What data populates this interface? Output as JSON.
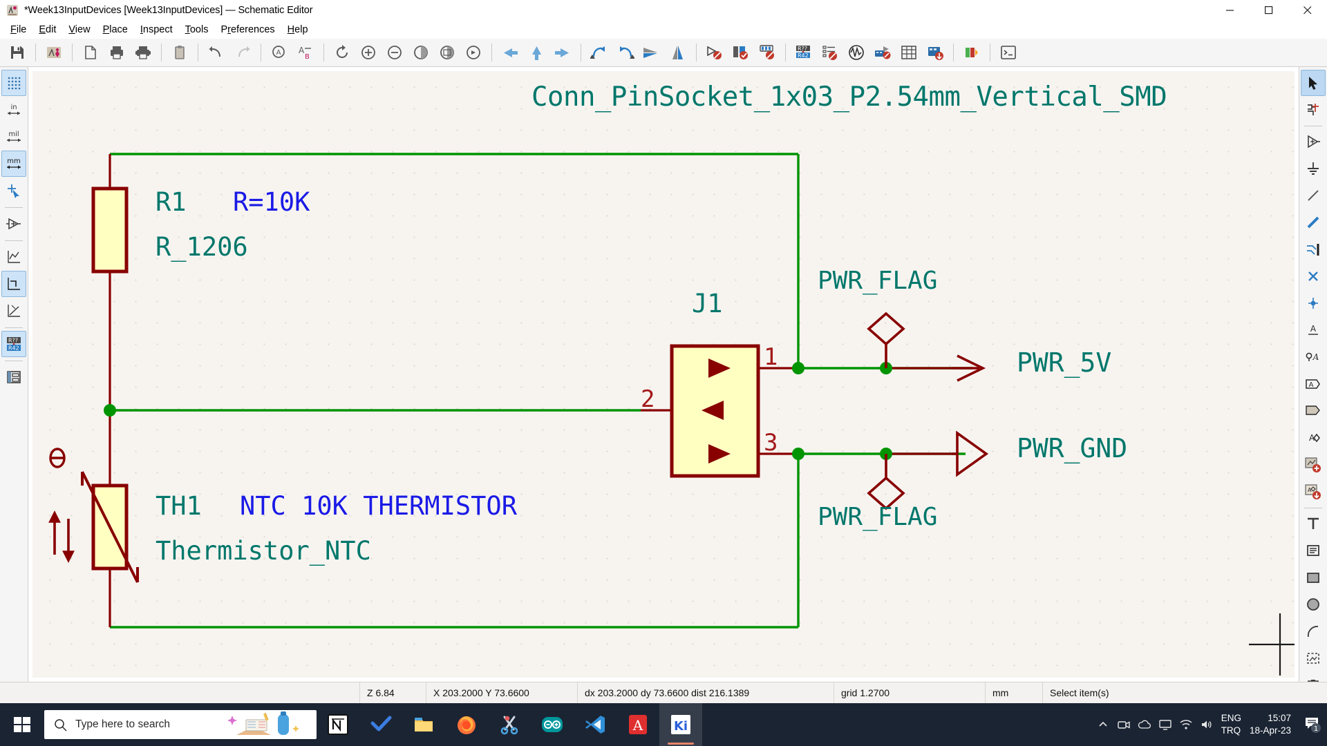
{
  "window": {
    "title": "*Week13InputDevices [Week13InputDevices] — Schematic Editor",
    "app_icon": "kicad-schematic-icon",
    "minimize": "–",
    "maximize": "☐",
    "close": "✕"
  },
  "menu": {
    "items": [
      {
        "label": "File",
        "mnemonic": "F"
      },
      {
        "label": "Edit",
        "mnemonic": "E"
      },
      {
        "label": "View",
        "mnemonic": "V"
      },
      {
        "label": "Place",
        "mnemonic": "P"
      },
      {
        "label": "Inspect",
        "mnemonic": "I"
      },
      {
        "label": "Tools",
        "mnemonic": "T"
      },
      {
        "label": "Preferences",
        "mnemonic": "r"
      },
      {
        "label": "Help",
        "mnemonic": "H"
      }
    ]
  },
  "toolbar": {
    "groups": [
      [
        "save-icon"
      ],
      [
        "open-project-manager-icon"
      ],
      [
        "new-sheet-icon",
        "print-icon",
        "plot-icon"
      ],
      [
        "paste-icon"
      ],
      [
        "undo-icon",
        "redo-icon"
      ],
      [
        "find-icon",
        "find-replace-icon"
      ],
      [
        "refresh-icon",
        "zoom-in-icon",
        "zoom-out-icon",
        "zoom-fit-icon",
        "zoom-objects-icon",
        "zoom-area-icon"
      ],
      [
        "leave-sheet-icon",
        "up-sheet-icon",
        "enter-sheet-icon"
      ],
      [
        "rotate-ccw-icon",
        "rotate-cw-icon",
        "mirror-horizontal-icon",
        "mirror-vertical-icon"
      ],
      [
        "annotate-icon",
        "erc-icon",
        "footprint-assign-icon"
      ],
      [
        "edit-symbol-fields-icon",
        "bom-icon",
        "simulator-icon",
        "open-pcb-icon",
        "spreadsheet-icon",
        "update-pcb-icon"
      ],
      [
        "library-editor-icon"
      ],
      [
        "scripting-console-icon"
      ]
    ]
  },
  "left_toolbar": {
    "items": [
      {
        "name": "toggle-grid-icon",
        "label": "",
        "selected": true
      },
      {
        "name": "units-inches-icon",
        "label": "in",
        "selected": false
      },
      {
        "name": "units-mils-icon",
        "label": "mil",
        "selected": false
      },
      {
        "name": "units-millimeters-icon",
        "label": "mm",
        "selected": true
      },
      {
        "name": "toggle-cursor-icon",
        "label": "",
        "selected": false
      },
      {
        "name": "hidden-pins-icon",
        "label": "",
        "selected": false
      },
      {
        "name": "free-angle-lines-icon",
        "label": "",
        "selected": false
      },
      {
        "name": "ortho-lines-icon",
        "label": "",
        "selected": true
      },
      {
        "name": "any-angle-lines-icon",
        "label": "",
        "selected": false
      },
      {
        "name": "annotation-display-icon",
        "label": "R42",
        "selected": true
      },
      {
        "name": "show-hierarchy-navigator-icon",
        "label": "",
        "selected": false
      }
    ]
  },
  "right_toolbar": {
    "items": [
      {
        "name": "select-tool-icon",
        "selected": true
      },
      {
        "name": "highlight-net-tool-icon",
        "selected": false
      },
      {
        "name": "place-symbol-tool-icon",
        "selected": false
      },
      {
        "name": "place-power-port-tool-icon",
        "selected": false
      },
      {
        "name": "draw-wire-tool-icon",
        "selected": false
      },
      {
        "name": "draw-bus-tool-icon",
        "selected": false
      },
      {
        "name": "wire-to-bus-entry-tool-icon",
        "selected": false
      },
      {
        "name": "no-connect-flag-tool-icon",
        "selected": false
      },
      {
        "name": "junction-tool-icon",
        "selected": false
      },
      {
        "name": "net-label-tool-icon",
        "selected": false
      },
      {
        "name": "global-label-tool-icon",
        "selected": false
      },
      {
        "name": "hierarchical-label-tool-icon",
        "selected": false
      },
      {
        "name": "sheet-pin-tool-icon",
        "selected": false
      },
      {
        "name": "hierarchical-sheet-tool-icon",
        "selected": false
      },
      {
        "name": "import-sheet-pin-tool-icon",
        "selected": false
      },
      {
        "name": "place-text-tool-icon",
        "selected": false
      },
      {
        "name": "place-textbox-tool-icon",
        "selected": false
      },
      {
        "name": "draw-rectangle-tool-icon",
        "selected": false
      },
      {
        "name": "draw-circle-tool-icon",
        "selected": false
      },
      {
        "name": "draw-arc-tool-icon",
        "selected": false
      },
      {
        "name": "draw-image-tool-icon",
        "selected": false
      },
      {
        "name": "delete-tool-icon",
        "selected": false
      }
    ]
  },
  "schematic": {
    "sheet_title": "Conn_PinSocket_1x03_P2.54mm_Vertical_SMD",
    "components": [
      {
        "name": "resistor-r1",
        "reference": "R1",
        "value": "R=10K",
        "footprint": "R_1206",
        "type": "resistor"
      },
      {
        "name": "thermistor-th1",
        "reference": "TH1",
        "value": "NTC 10K THERMISTOR",
        "footprint": "Thermistor_NTC",
        "type": "thermistor-ntc"
      },
      {
        "name": "connector-j1",
        "reference": "J1",
        "type": "pin-socket-1x03",
        "pins": [
          "1",
          "2",
          "3"
        ]
      }
    ],
    "power_ports": [
      {
        "name": "power-port-pwr-5v",
        "label": "PWR_5V",
        "style": "input-arrow"
      },
      {
        "name": "power-port-pwr-gnd",
        "label": "PWR_GND",
        "style": "output-arrow"
      }
    ],
    "power_flags": [
      {
        "name": "power-flag-top",
        "label": "PWR_FLAG"
      },
      {
        "name": "power-flag-bottom",
        "label": "PWR_FLAG"
      }
    ],
    "colors": {
      "wire_green": "#009400",
      "component_red": "#880000",
      "component_fill": "#ffffc2",
      "reference_teal": "#00776b",
      "value_blue": "#1a1ae6",
      "pin_number_red": "#a41a1a",
      "canvas_bg": "#f7f4f0"
    }
  },
  "statusbar": {
    "zoom": "Z 6.84",
    "coords": "X 203.2000  Y 73.6600",
    "delta": "dx 203.2000  dy 73.6600  dist 216.1389",
    "grid": "grid 1.2700",
    "units": "mm",
    "mode": "Select item(s)"
  },
  "taskbar": {
    "start_icon": "windows-start-icon",
    "search": {
      "placeholder": "Type here to search",
      "icon": "search-icon"
    },
    "apps": [
      {
        "name": "notion-taskbar-icon",
        "running": false,
        "active": false
      },
      {
        "name": "todoist-taskbar-icon",
        "running": false,
        "active": false
      },
      {
        "name": "file-explorer-taskbar-icon",
        "running": false,
        "active": false
      },
      {
        "name": "firefox-taskbar-icon",
        "running": true,
        "active": false
      },
      {
        "name": "snipping-tool-taskbar-icon",
        "running": false,
        "active": false
      },
      {
        "name": "arduino-ide-taskbar-icon",
        "running": true,
        "active": false
      },
      {
        "name": "vscode-taskbar-icon",
        "running": true,
        "active": false
      },
      {
        "name": "adobe-acrobat-taskbar-icon",
        "running": true,
        "active": false
      },
      {
        "name": "kicad-taskbar-icon",
        "running": true,
        "active": true
      }
    ],
    "tray": {
      "expand": "show-hidden-icons-icon",
      "icons": [
        "meet-now-icon",
        "onedrive-icon",
        "display-icon",
        "wifi-icon",
        "volume-icon"
      ],
      "language": "ENG",
      "keyboard": "TRQ",
      "time": "15:07",
      "date": "18-Apr-23",
      "notification_count": "1"
    }
  }
}
